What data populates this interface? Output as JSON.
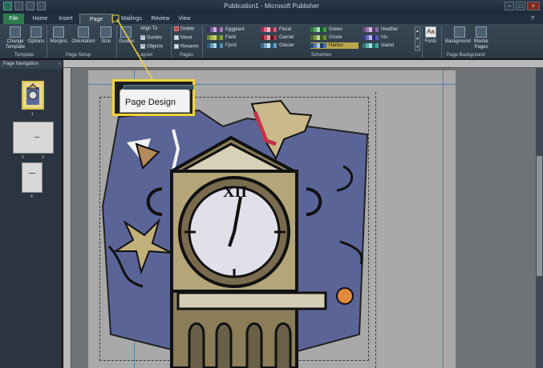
{
  "window": {
    "title": "Publication1 - Microsoft Publisher"
  },
  "tabs": [
    {
      "label": "File"
    },
    {
      "label": "Home"
    },
    {
      "label": "Insert"
    },
    {
      "label": "Page Design"
    },
    {
      "label": "Mailings"
    },
    {
      "label": "Review"
    },
    {
      "label": "View"
    }
  ],
  "ribbon": {
    "template": {
      "change_template": "Change Template",
      "options": "Options",
      "group_label": "Template"
    },
    "page_setup": {
      "margins": "Margins",
      "orientation": "Orientation",
      "size": "Size",
      "group_label": "Page Setup"
    },
    "layout": {
      "guides_button": "Guides",
      "align_to": "Align To",
      "guides_check": "Guides",
      "objects_check": "Objects",
      "group_label": "Layout"
    },
    "pages": {
      "delete": "Delete",
      "move": "Move",
      "rename": "Rename",
      "group_label": "Pages"
    },
    "schemes": {
      "group_label": "Schemes",
      "items": [
        {
          "label": "Eggplant",
          "colors": [
            "#3b2b5a",
            "#7a5fa0",
            "#c8b2dc",
            "#5a3b6e",
            "#a07ab8"
          ]
        },
        {
          "label": "Field",
          "colors": [
            "#6a8a3a",
            "#a0b850",
            "#d8c870",
            "#4a6a2a",
            "#88a040"
          ]
        },
        {
          "label": "Fjord",
          "colors": [
            "#2a5a7a",
            "#6a9ab8",
            "#b8d2e2",
            "#1a4a6a",
            "#5a8aa8"
          ]
        },
        {
          "label": "Floral",
          "colors": [
            "#a82a5a",
            "#d86a8a",
            "#f0b8c8",
            "#882a4a",
            "#c85a7a"
          ]
        },
        {
          "label": "Garnet",
          "colors": [
            "#7a1a2a",
            "#b84a5a",
            "#e0a0a8",
            "#5a1a2a",
            "#a03a4a"
          ]
        },
        {
          "label": "Glacier",
          "colors": [
            "#3a6a8a",
            "#7aa8c8",
            "#c8e0ee",
            "#2a5a7a",
            "#6a98b8"
          ]
        },
        {
          "label": "Green",
          "colors": [
            "#2a7a3a",
            "#5aa86a",
            "#a8d8b0",
            "#1a5a2a",
            "#4a984a"
          ]
        },
        {
          "label": "Grove",
          "colors": [
            "#4a6a2a",
            "#7a9a4a",
            "#c0d098",
            "#3a5a1a",
            "#6a8a3a"
          ]
        },
        {
          "label": "Harbor",
          "colors": [
            "#2a4a7a",
            "#5a7ab0",
            "#a8c0e0",
            "#1a3a6a",
            "#4a6aa0"
          ]
        },
        {
          "label": "Heather",
          "colors": [
            "#6a4a7a",
            "#9a7ab0",
            "#d0c0e0",
            "#5a3a6a",
            "#8a6aa0"
          ]
        },
        {
          "label": "Iris",
          "colors": [
            "#3a3a8a",
            "#6a6ab8",
            "#b8b8e8",
            "#2a2a7a",
            "#5a5aa8"
          ]
        },
        {
          "label": "Island",
          "colors": [
            "#2a7a7a",
            "#5ab0a8",
            "#a8e0d8",
            "#1a6a6a",
            "#4aa098"
          ]
        }
      ],
      "selected": "Harbor"
    },
    "fonts": {
      "label": "Fonts"
    },
    "background": {
      "background": "Background",
      "master_pages": "Master Pages",
      "group_label": "Page Background"
    }
  },
  "nav": {
    "title": "Page Navigation",
    "pages": [
      {
        "label": "1"
      },
      {
        "label": "2"
      },
      {
        "label": "3"
      },
      {
        "label": "4"
      }
    ]
  },
  "callout": {
    "text": "Page Design"
  },
  "colors": {
    "accent_callout": "#f2d33a",
    "file_tab": "#2f7b4e",
    "guide_blue": "#4a86b0"
  }
}
